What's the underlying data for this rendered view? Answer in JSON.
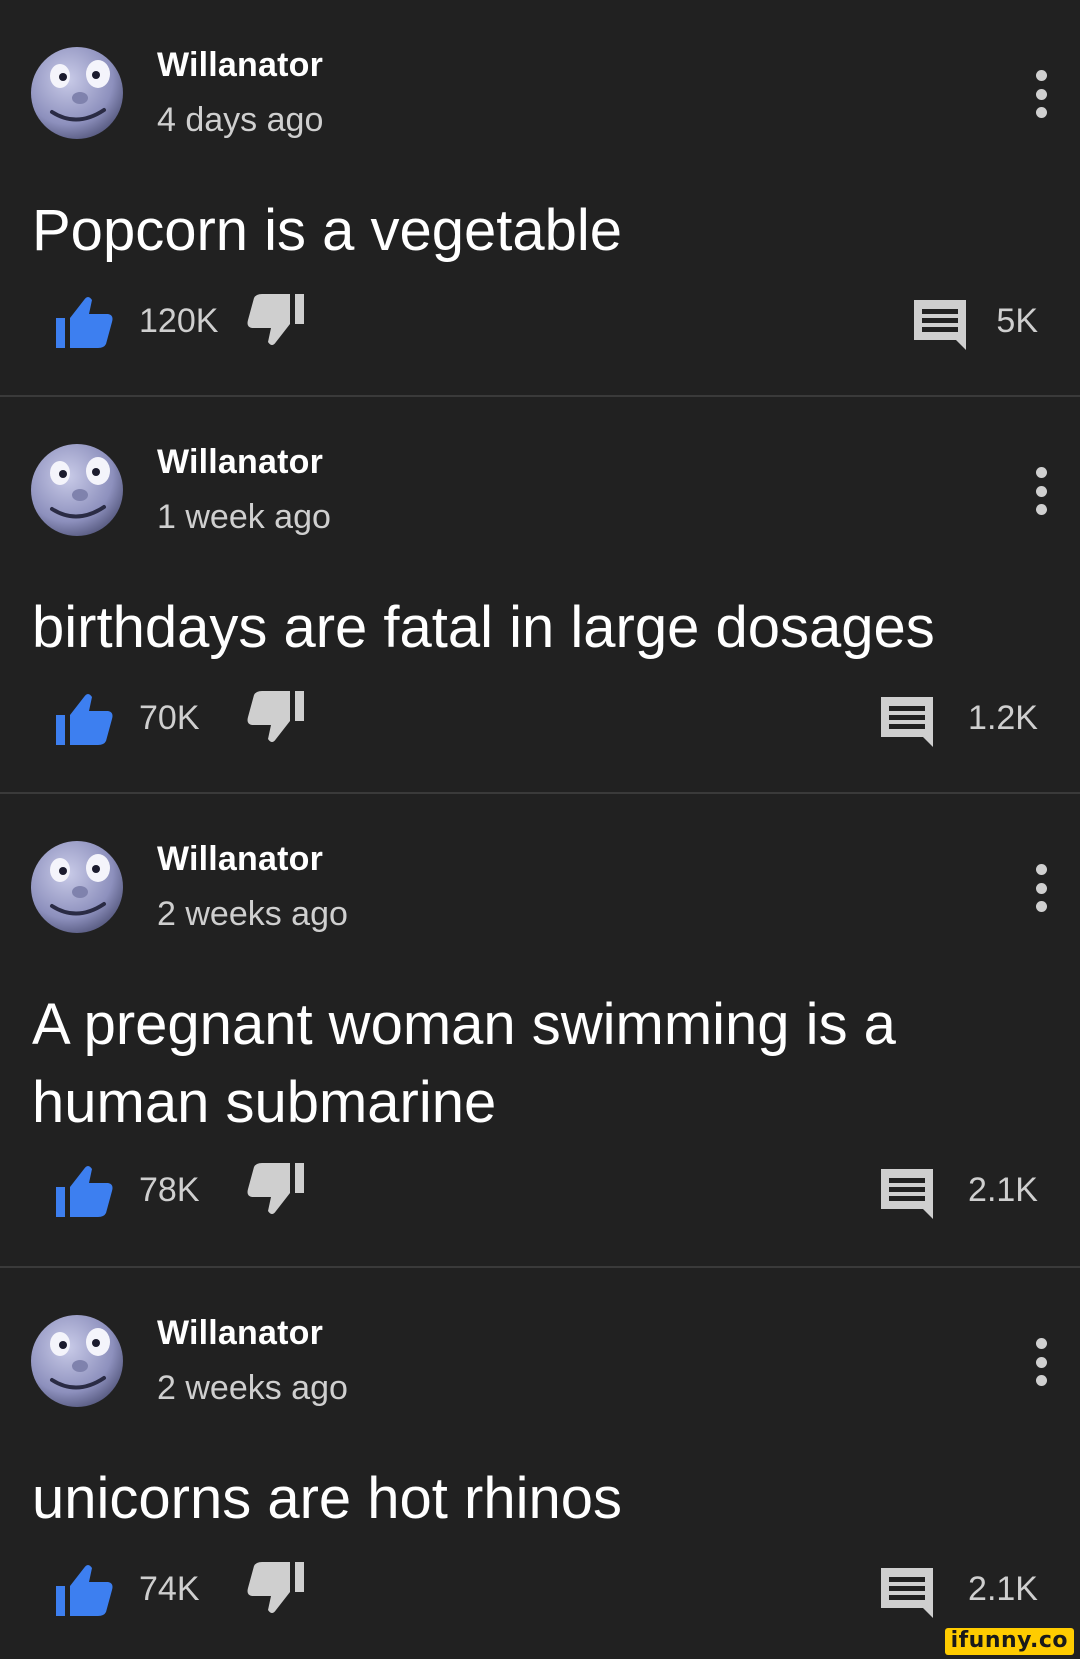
{
  "colors": {
    "background": "#212121",
    "divider": "#3a3a3a",
    "like_blue": "#3d7ff0",
    "icon_grey": "#cfcfcf",
    "text_primary": "#ffffff",
    "text_secondary": "#cfcfcf",
    "watermark_bg": "#ffcc00"
  },
  "comments": [
    {
      "author": "Willanator",
      "time": "4 days ago",
      "text": "Popcorn is a vegetable",
      "likes": "120K",
      "replies": "5K",
      "avatar_icon": "cartoon-face-avatar",
      "menu_icon": "more-vertical-icon"
    },
    {
      "author": "Willanator",
      "time": "1 week ago",
      "text": "birthdays are fatal in large dosages",
      "likes": "70K",
      "replies": "1.2K",
      "avatar_icon": "cartoon-face-avatar",
      "menu_icon": "more-vertical-icon"
    },
    {
      "author": "Willanator",
      "time": "2 weeks ago",
      "text": "A pregnant woman swimming is a human submarine",
      "likes": "78K",
      "replies": "2.1K",
      "avatar_icon": "cartoon-face-avatar",
      "menu_icon": "more-vertical-icon"
    },
    {
      "author": "Willanator",
      "time": "2 weeks ago",
      "text": "unicorns are hot rhinos",
      "likes": "74K",
      "replies": "2.1K",
      "avatar_icon": "cartoon-face-avatar",
      "menu_icon": "more-vertical-icon"
    }
  ],
  "watermark": {
    "text": "ifunny.co"
  }
}
